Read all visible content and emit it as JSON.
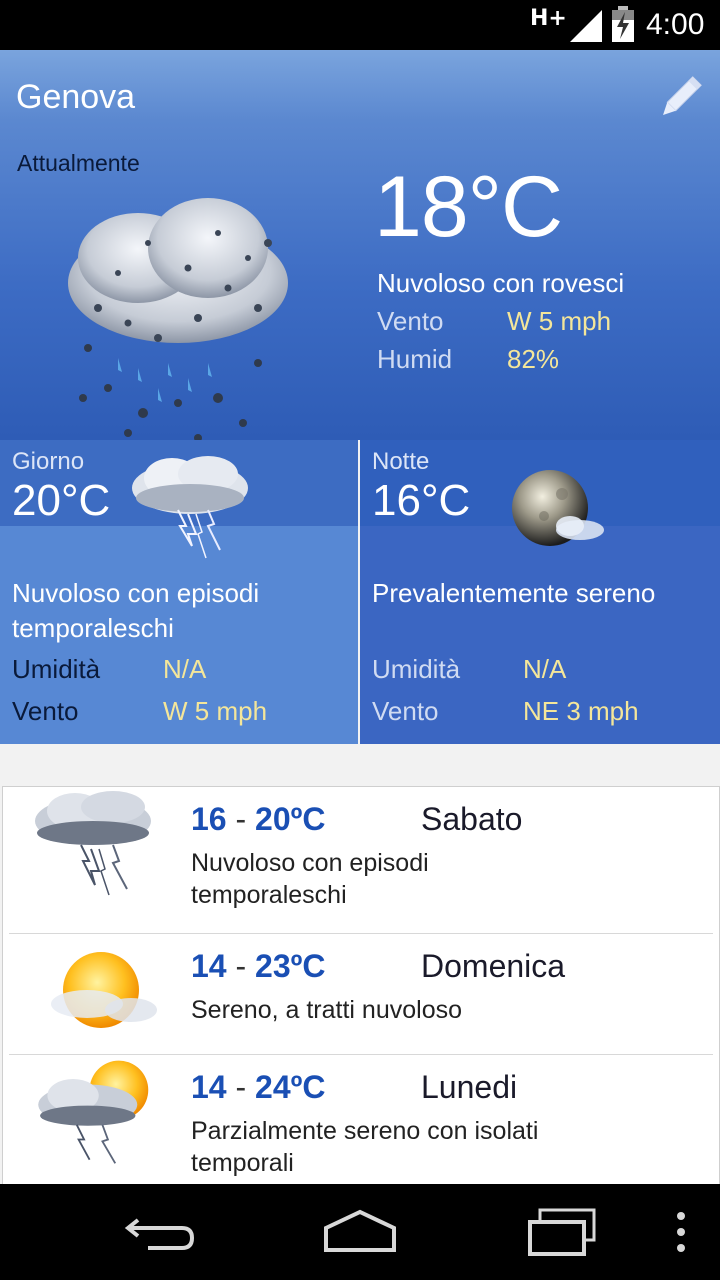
{
  "status": {
    "network": "H+",
    "time": "4:00"
  },
  "current": {
    "city": "Genova",
    "label": "Attualmente",
    "temperature": "18°C",
    "condition": "Nuvoloso con rovesci",
    "wind_label": "Vento",
    "wind_value": "W 5 mph",
    "humidity_label": "Humid",
    "humidity_value": "82%"
  },
  "day": {
    "period": "Giorno",
    "temperature": "20°C",
    "condition": "Nuvoloso con episodi temporaleschi",
    "humidity_label": "Umidità",
    "humidity_value": "N/A",
    "wind_label": "Vento",
    "wind_value": "W 5 mph"
  },
  "night": {
    "period": "Notte",
    "temperature": "16°C",
    "condition": "Prevalentemente sereno",
    "humidity_label": "Umidità",
    "humidity_value": "N/A",
    "wind_label": "Vento",
    "wind_value": "NE 3 mph"
  },
  "forecast": [
    {
      "low": "16",
      "sep": " - ",
      "high": "20ºC",
      "day": "Sabato",
      "condition": "Nuvoloso con episodi temporaleschi",
      "icon": "thunderstorm-cloud-icon"
    },
    {
      "low": "14",
      "sep": " - ",
      "high": "23ºC",
      "day": "Domenica",
      "condition": "Sereno, a tratti nuvoloso",
      "icon": "sun-cloud-icon"
    },
    {
      "low": "14",
      "sep": " - ",
      "high": "24ºC",
      "day": "Lunedi",
      "condition": "Parzialmente sereno con isolati temporali",
      "icon": "sun-thunderstorm-icon"
    }
  ],
  "colors": {
    "header_blue": "#3d6cc4",
    "accent_yellow": "#f4e69a",
    "forecast_blue": "#1a4fb4"
  }
}
